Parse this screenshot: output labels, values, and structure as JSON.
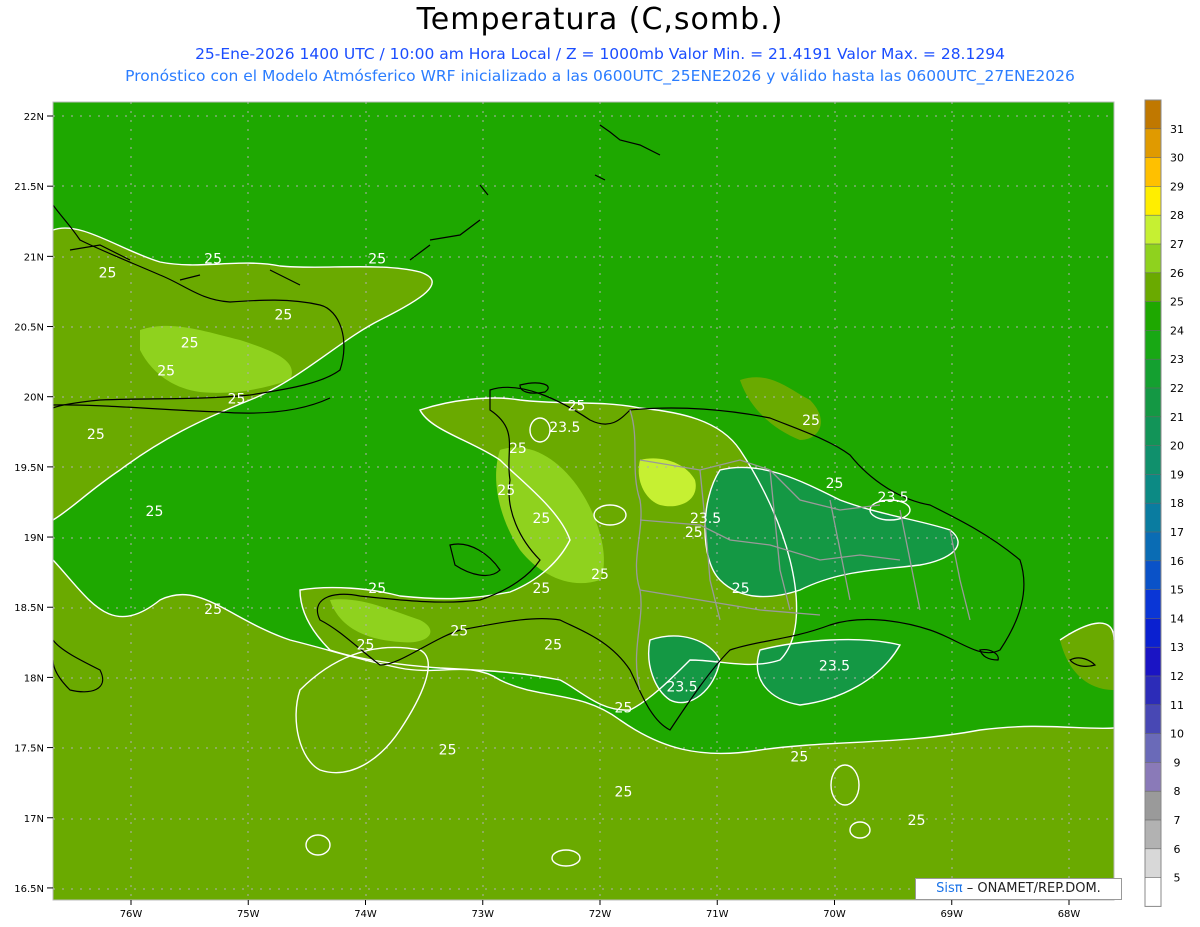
{
  "header": {
    "title": "Temperatura (C,somb.)",
    "line1": "25-Ene-2026 1400 UTC / 10:00 am Hora Local / Z = 1000mb   Valor Min. = 21.4191  Valor Max. = 28.1294",
    "line2": "Pronóstico con el Modelo Atmósferico WRF inicializado a las 0600UTC_25ENE2026 y válido hasta las  0600UTC_27ENE2026"
  },
  "map": {
    "lat_labels": [
      "22N",
      "21.5N",
      "21N",
      "20.5N",
      "20N",
      "19.5N",
      "19N",
      "18.5N",
      "18N",
      "17.5N",
      "17N",
      "16.5N"
    ],
    "lat_values": [
      22,
      21.5,
      21,
      20.5,
      20,
      19.5,
      19,
      18.5,
      18,
      17.5,
      17,
      16.5
    ],
    "lon_labels": [
      "76W",
      "75W",
      "74W",
      "73W",
      "72W",
      "71W",
      "70W",
      "69W",
      "68W"
    ],
    "lon_values": [
      -76,
      -75,
      -74,
      -73,
      -72,
      -71,
      -70,
      -69,
      -68
    ],
    "contour_labels": [
      {
        "text": "25",
        "lon": -75.3,
        "lat": 20.95
      },
      {
        "text": "25",
        "lon": -76.2,
        "lat": 20.85
      },
      {
        "text": "25",
        "lon": -73.9,
        "lat": 20.95
      },
      {
        "text": "25",
        "lon": -74.7,
        "lat": 20.55
      },
      {
        "text": "25",
        "lon": -75.5,
        "lat": 20.35
      },
      {
        "text": "25",
        "lon": -75.7,
        "lat": 20.15
      },
      {
        "text": "25",
        "lon": -75.1,
        "lat": 19.95
      },
      {
        "text": "25",
        "lon": -76.3,
        "lat": 19.7
      },
      {
        "text": "25",
        "lon": -75.8,
        "lat": 19.15
      },
      {
        "text": "23.5",
        "lon": -72.3,
        "lat": 19.75
      },
      {
        "text": "25",
        "lon": -72.2,
        "lat": 19.9
      },
      {
        "text": "25",
        "lon": -70.2,
        "lat": 19.8
      },
      {
        "text": "25",
        "lon": -72.7,
        "lat": 19.6
      },
      {
        "text": "25",
        "lon": -72.8,
        "lat": 19.3
      },
      {
        "text": "25",
        "lon": -72.5,
        "lat": 19.1
      },
      {
        "text": "25",
        "lon": -70.0,
        "lat": 19.35
      },
      {
        "text": "23.5",
        "lon": -69.5,
        "lat": 19.25
      },
      {
        "text": "23.5",
        "lon": -71.1,
        "lat": 19.1
      },
      {
        "text": "25",
        "lon": -71.2,
        "lat": 19.0
      },
      {
        "text": "25",
        "lon": -72.0,
        "lat": 18.7
      },
      {
        "text": "25",
        "lon": -73.9,
        "lat": 18.6
      },
      {
        "text": "25",
        "lon": -72.5,
        "lat": 18.6
      },
      {
        "text": "25",
        "lon": -70.8,
        "lat": 18.6
      },
      {
        "text": "25",
        "lon": -75.3,
        "lat": 18.45
      },
      {
        "text": "25",
        "lon": -73.2,
        "lat": 18.3
      },
      {
        "text": "25",
        "lon": -74.0,
        "lat": 18.2
      },
      {
        "text": "25",
        "lon": -72.4,
        "lat": 18.2
      },
      {
        "text": "23.5",
        "lon": -70.0,
        "lat": 18.05
      },
      {
        "text": "23.5",
        "lon": -71.3,
        "lat": 17.9
      },
      {
        "text": "25",
        "lon": -71.8,
        "lat": 17.75
      },
      {
        "text": "25",
        "lon": -73.3,
        "lat": 17.45
      },
      {
        "text": "25",
        "lon": -70.3,
        "lat": 17.4
      },
      {
        "text": "25",
        "lon": -71.8,
        "lat": 17.15
      },
      {
        "text": "25",
        "lon": -69.3,
        "lat": 16.95
      }
    ]
  },
  "colorbar": {
    "labels": [
      "31",
      "30",
      "29",
      "28",
      "27",
      "26",
      "25",
      "24",
      "23",
      "22",
      "21",
      "20",
      "19",
      "18",
      "17",
      "16",
      "15",
      "14",
      "13",
      "12",
      "11",
      "10",
      "9",
      "8",
      "7",
      "6",
      "5"
    ],
    "colors": [
      "#c07800",
      "#e09a00",
      "#ffc000",
      "#ffee00",
      "#c6f032",
      "#8fd21e",
      "#6aaa00",
      "#1ea800",
      "#18a814",
      "#14a030",
      "#149844",
      "#129458",
      "#10906c",
      "#0c8a84",
      "#0a7ca0",
      "#0a6cb4",
      "#0a52c8",
      "#0a36d6",
      "#0a20d0",
      "#1a14c4",
      "#2c2cb8",
      "#4848b4",
      "#6a6ab8",
      "#8a7ab8",
      "#9a9a9a",
      "#b2b2b2",
      "#d8d8d8",
      "#ffffff"
    ]
  },
  "colors": {
    "ocean": "#1ea800",
    "land_warm": "#6aaa00",
    "hot": "#8fd21e",
    "hotter": "#c6f032",
    "cool": "#149844",
    "coast": "#000000",
    "border": "#9a9a9a",
    "contour": "#ffffff"
  },
  "credit": {
    "brand": "Sisπ",
    "org": "– ONAMET/REP.DOM."
  }
}
